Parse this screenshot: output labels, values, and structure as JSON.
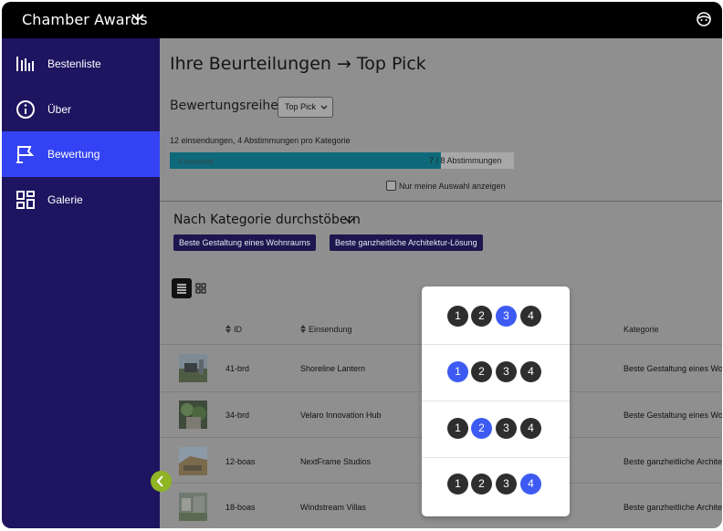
{
  "app": {
    "title": "Chamber Awards"
  },
  "sidebar": {
    "items": [
      {
        "label": "Bestenliste",
        "icon": "bar-chart-icon"
      },
      {
        "label": "Über",
        "icon": "info-icon"
      },
      {
        "label": "Bewertung",
        "icon": "flag-icon",
        "active": true
      },
      {
        "label": "Galerie",
        "icon": "gallery-icon"
      }
    ]
  },
  "main": {
    "title": "Ihre Beurteilungen → Top Pick",
    "series_label": "Bewertungsreihe",
    "series_select": "Top Pick",
    "summary": "12 einsendungen, 4 Abstimmungen pro Kategorie",
    "progress": {
      "label": "Fortschritt",
      "count_text": "7 / 8 Abstimmungen",
      "value": 0.875
    },
    "only_mine_label": "Nur meine Auswahl anzeigen",
    "browse_title": "Nach Kategorie durchstöbern",
    "categories": [
      "Beste Gestaltung eines Wohnraums",
      "Beste ganzheitliche Architektur-Lösung"
    ]
  },
  "table": {
    "headers": {
      "id": "ID",
      "submission": "Einsendung",
      "category": "Kategorie"
    },
    "rows": [
      {
        "id": "41-brd",
        "name": "Shoreline Lantern",
        "category": "Beste Gestaltung eines Wo"
      },
      {
        "id": "34-brd",
        "name": "Velaro Innovation Hub",
        "category": "Beste Gestaltung eines Wo"
      },
      {
        "id": "12-boas",
        "name": "NextFrame Studios",
        "category": "Beste ganzheitliche Archite"
      },
      {
        "id": "18-boas",
        "name": "Windstream Villas",
        "category": "Beste ganzheitliche Archite"
      }
    ]
  },
  "score_popover": {
    "options": [
      "1",
      "2",
      "3",
      "4"
    ],
    "selected": [
      3,
      1,
      2,
      4
    ]
  },
  "colors": {
    "sidebar": "#1e1460",
    "active": "#3343f3",
    "progress": "#0e6a7a",
    "selected_score": "#3d5bf2",
    "collapse": "#8fb424"
  }
}
